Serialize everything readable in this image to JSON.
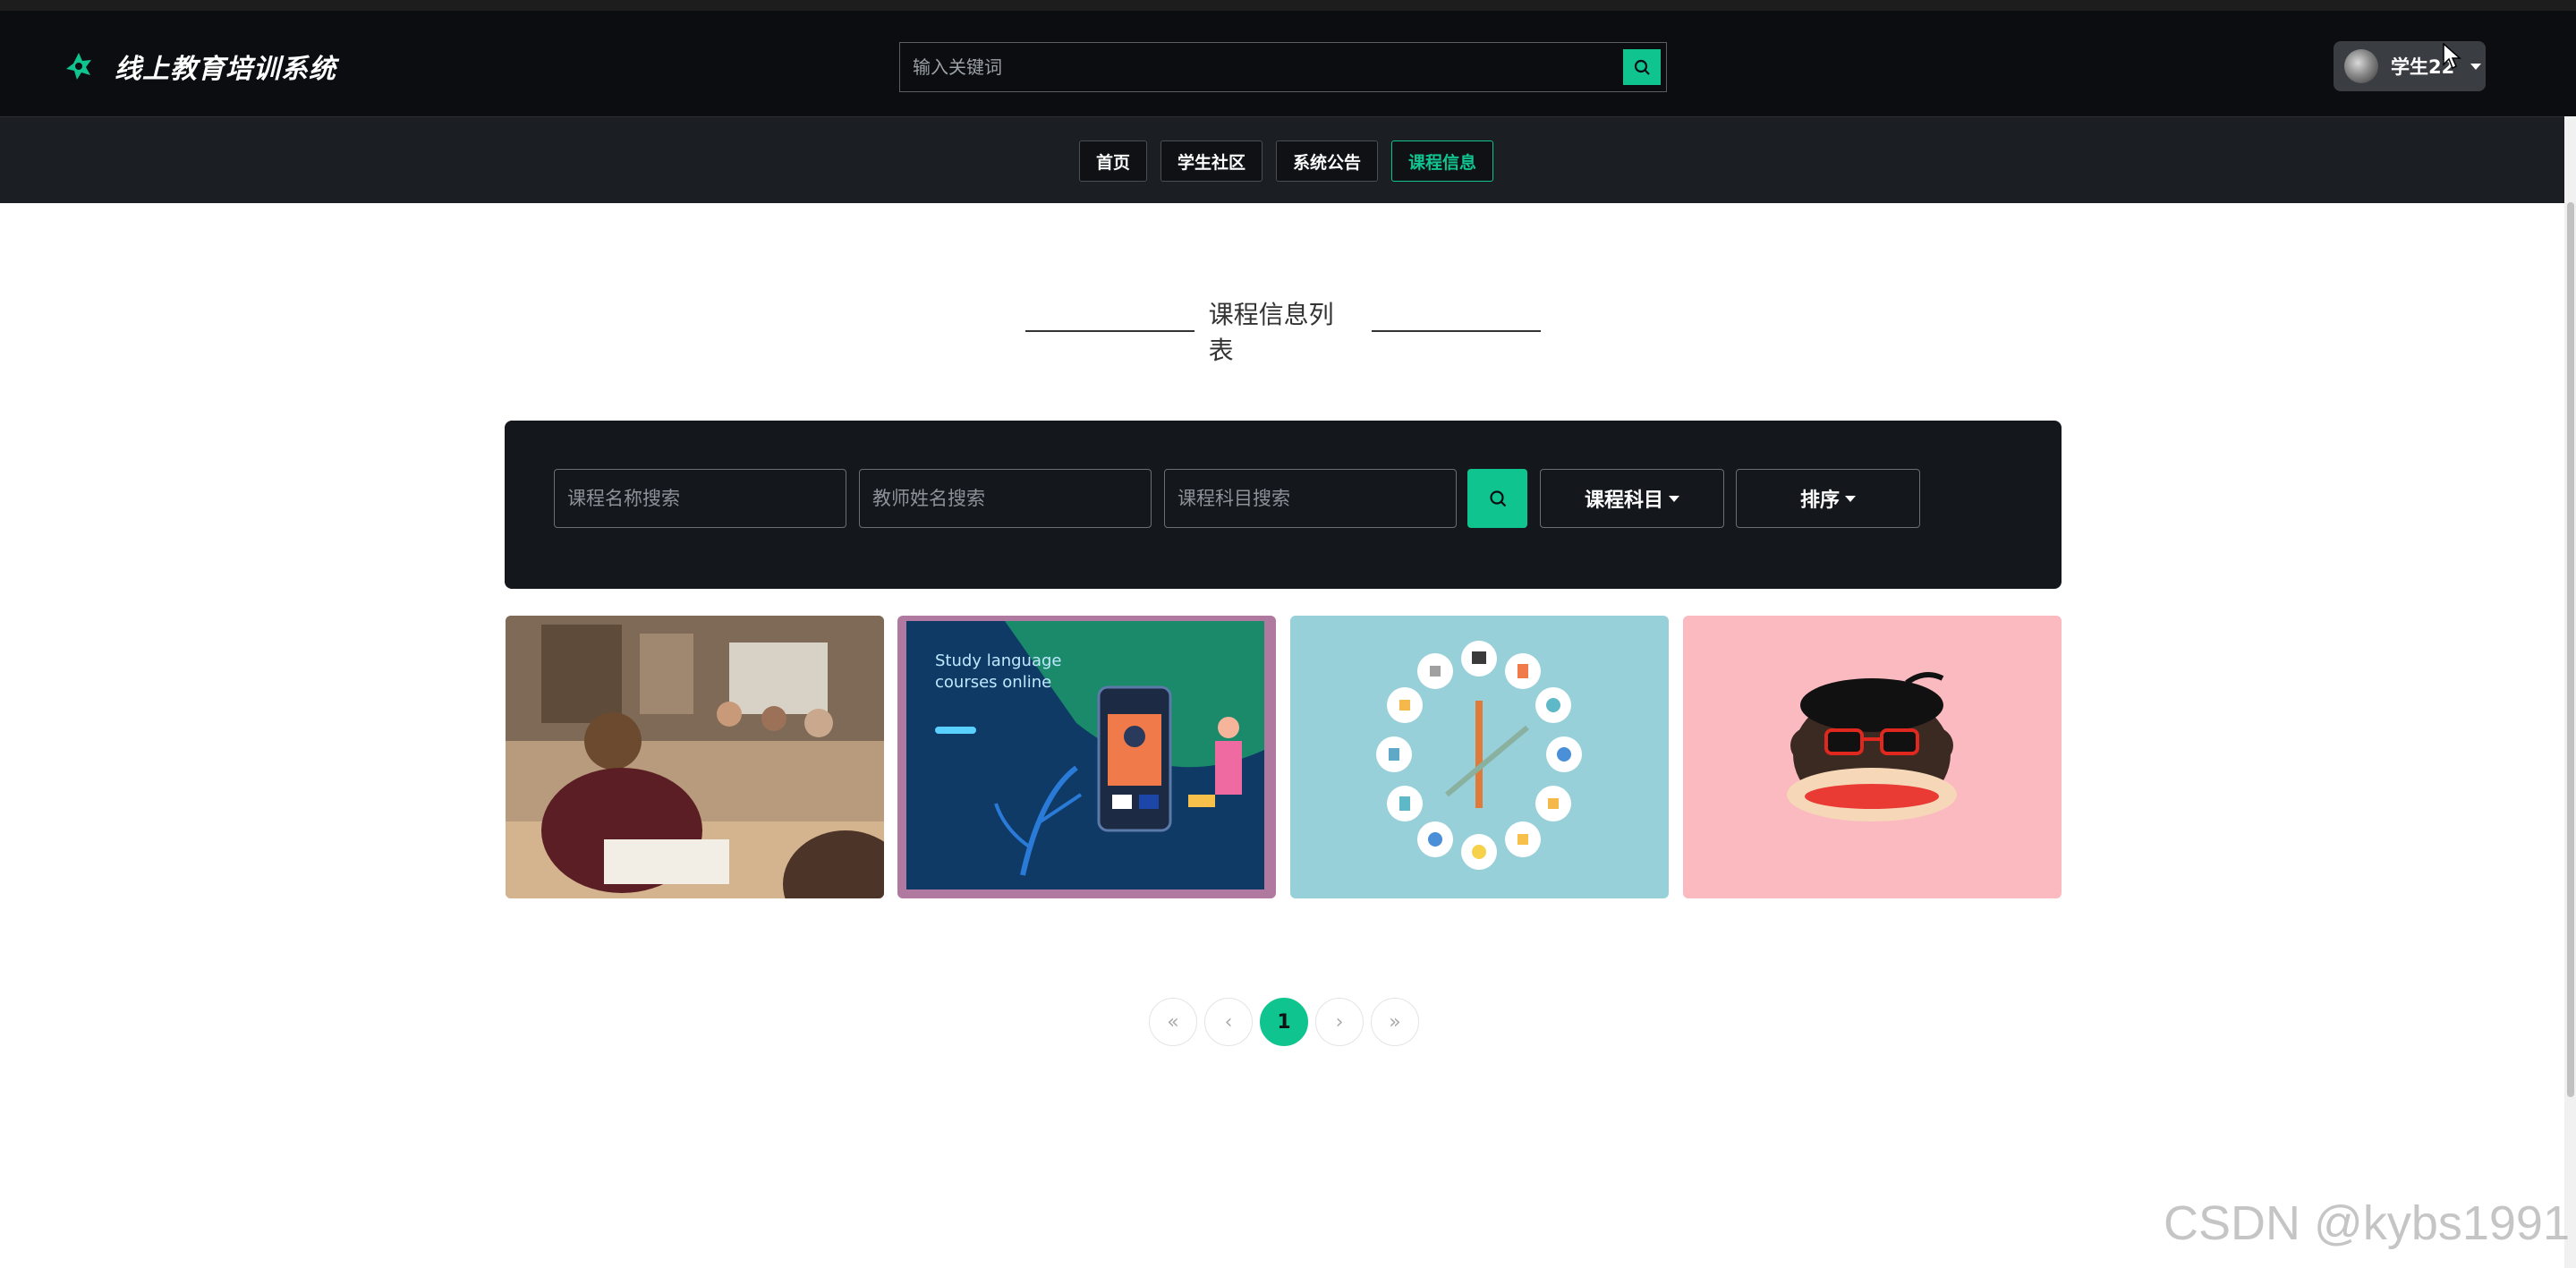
{
  "brand": {
    "title": "线上教育培训系统"
  },
  "header_search": {
    "placeholder": "输入关键词"
  },
  "user": {
    "name": "学生22"
  },
  "nav": {
    "items": [
      {
        "label": "首页",
        "active": false
      },
      {
        "label": "学生社区",
        "active": false
      },
      {
        "label": "系统公告",
        "active": false
      },
      {
        "label": "课程信息",
        "active": true
      }
    ]
  },
  "section": {
    "title": "课程信息列表"
  },
  "filters": {
    "course_name_placeholder": "课程名称搜索",
    "teacher_name_placeholder": "教师姓名搜索",
    "course_subject_placeholder": "课程科目搜索",
    "subject_dropdown_label": "课程科目",
    "sort_dropdown_label": "排序"
  },
  "cards": [
    {
      "image": "classroom-students-photo"
    },
    {
      "image": "study-language-illustration",
      "caption_line1": "Study language",
      "caption_line2": "courses online"
    },
    {
      "image": "education-icons-clock-illustration"
    },
    {
      "image": "monkey-sunglasses-illustration"
    }
  ],
  "pagination": {
    "first": "«",
    "prev": "‹",
    "current": "1",
    "next": "›",
    "last": "»"
  },
  "watermark": "CSDN @kybs1991",
  "colors": {
    "accent": "#10c490",
    "header_bg": "#0b0d11",
    "nav_bg": "#1b1e23",
    "panel_bg": "#14171c"
  }
}
